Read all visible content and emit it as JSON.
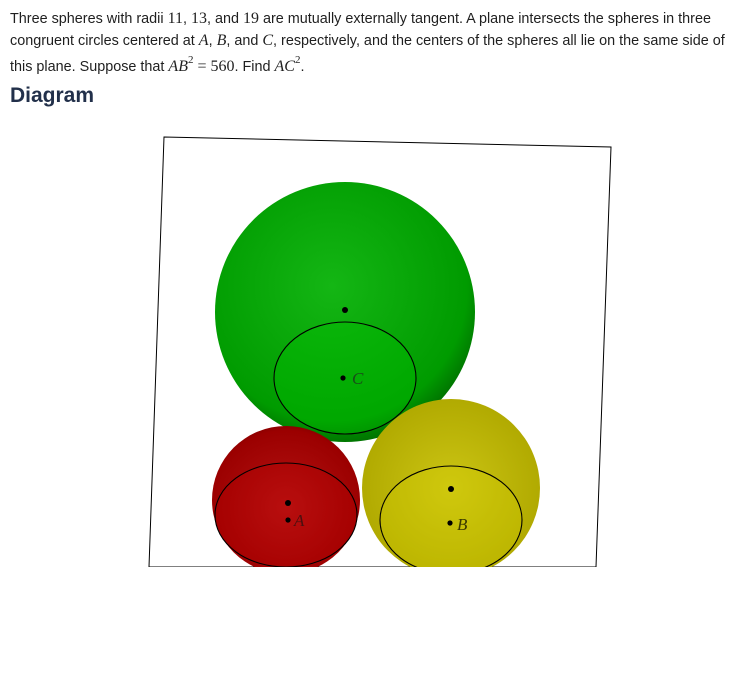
{
  "problem": {
    "t1": "Three spheres with radii ",
    "r1": "11",
    "c1": ", ",
    "r2": "13",
    "c2": ", and ",
    "r3": "19",
    "t2": " are mutually externally tangent. A plane intersects the spheres in three congruent circles centered at ",
    "A": "A",
    "c3": ", ",
    "B": "B",
    "c4": ", and ",
    "C": "C",
    "t3": ", respectively, and the centers of the spheres all lie on the same side of this plane. Suppose that ",
    "AB": "AB",
    "sq1": "2",
    "eq": " = 560",
    "t4": ". Find ",
    "AC": "AC",
    "sq2": "2",
    "t5": "."
  },
  "section": {
    "heading": "Diagram"
  },
  "diagram": {
    "labels": {
      "A": "A",
      "B": "B",
      "C": "C"
    },
    "colors": {
      "sphere_c": "#00b000",
      "sphere_a": "#b00000",
      "sphere_b": "#c8c000",
      "plane_edge": "#000000"
    }
  }
}
